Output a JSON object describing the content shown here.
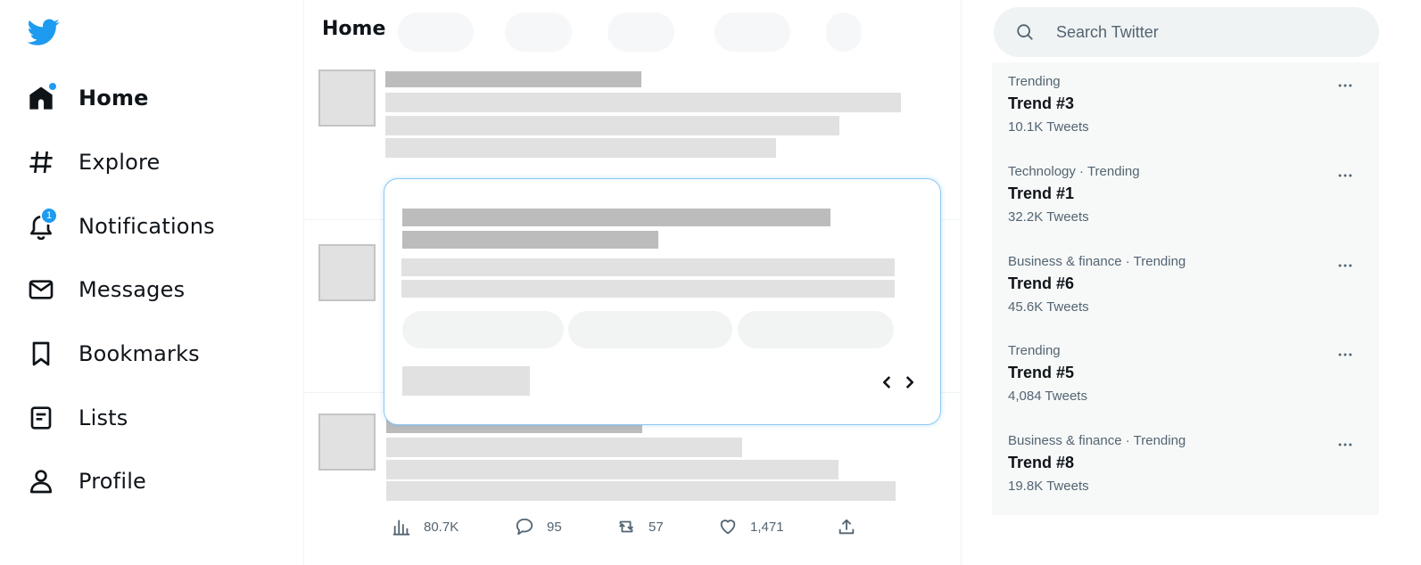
{
  "colors": {
    "accent": "#1d9bf0",
    "text": "#0f1419",
    "muted": "#536471",
    "placeholder_dark": "#bcbcbc",
    "placeholder_light": "#e1e1e1"
  },
  "sidebar": {
    "logo_icon": "twitter-bird-icon",
    "items": [
      {
        "label": "Home",
        "icon": "home-icon",
        "active": true,
        "dot": true
      },
      {
        "label": "Explore",
        "icon": "hashtag-icon"
      },
      {
        "label": "Notifications",
        "icon": "bell-icon",
        "badge": "1"
      },
      {
        "label": "Messages",
        "icon": "envelope-icon"
      },
      {
        "label": "Bookmarks",
        "icon": "bookmark-icon"
      },
      {
        "label": "Lists",
        "icon": "list-icon"
      },
      {
        "label": "Profile",
        "icon": "person-icon"
      }
    ]
  },
  "main": {
    "title": "Home",
    "actions": {
      "views": "80.7K",
      "replies": "95",
      "retweets": "57",
      "likes": "1,471"
    }
  },
  "search": {
    "placeholder": "Search Twitter"
  },
  "trends": [
    {
      "context": "Trending",
      "name": "Trend #3",
      "count": "10.1K Tweets"
    },
    {
      "context": "Technology · Trending",
      "name": "Trend #1",
      "count": "32.2K Tweets"
    },
    {
      "context": "Business & finance · Trending",
      "name": "Trend #6",
      "count": "45.6K Tweets"
    },
    {
      "context": "Trending",
      "name": "Trend #5",
      "count": "4,084 Tweets"
    },
    {
      "context": "Business & finance · Trending",
      "name": "Trend #8",
      "count": "19.8K Tweets"
    }
  ]
}
